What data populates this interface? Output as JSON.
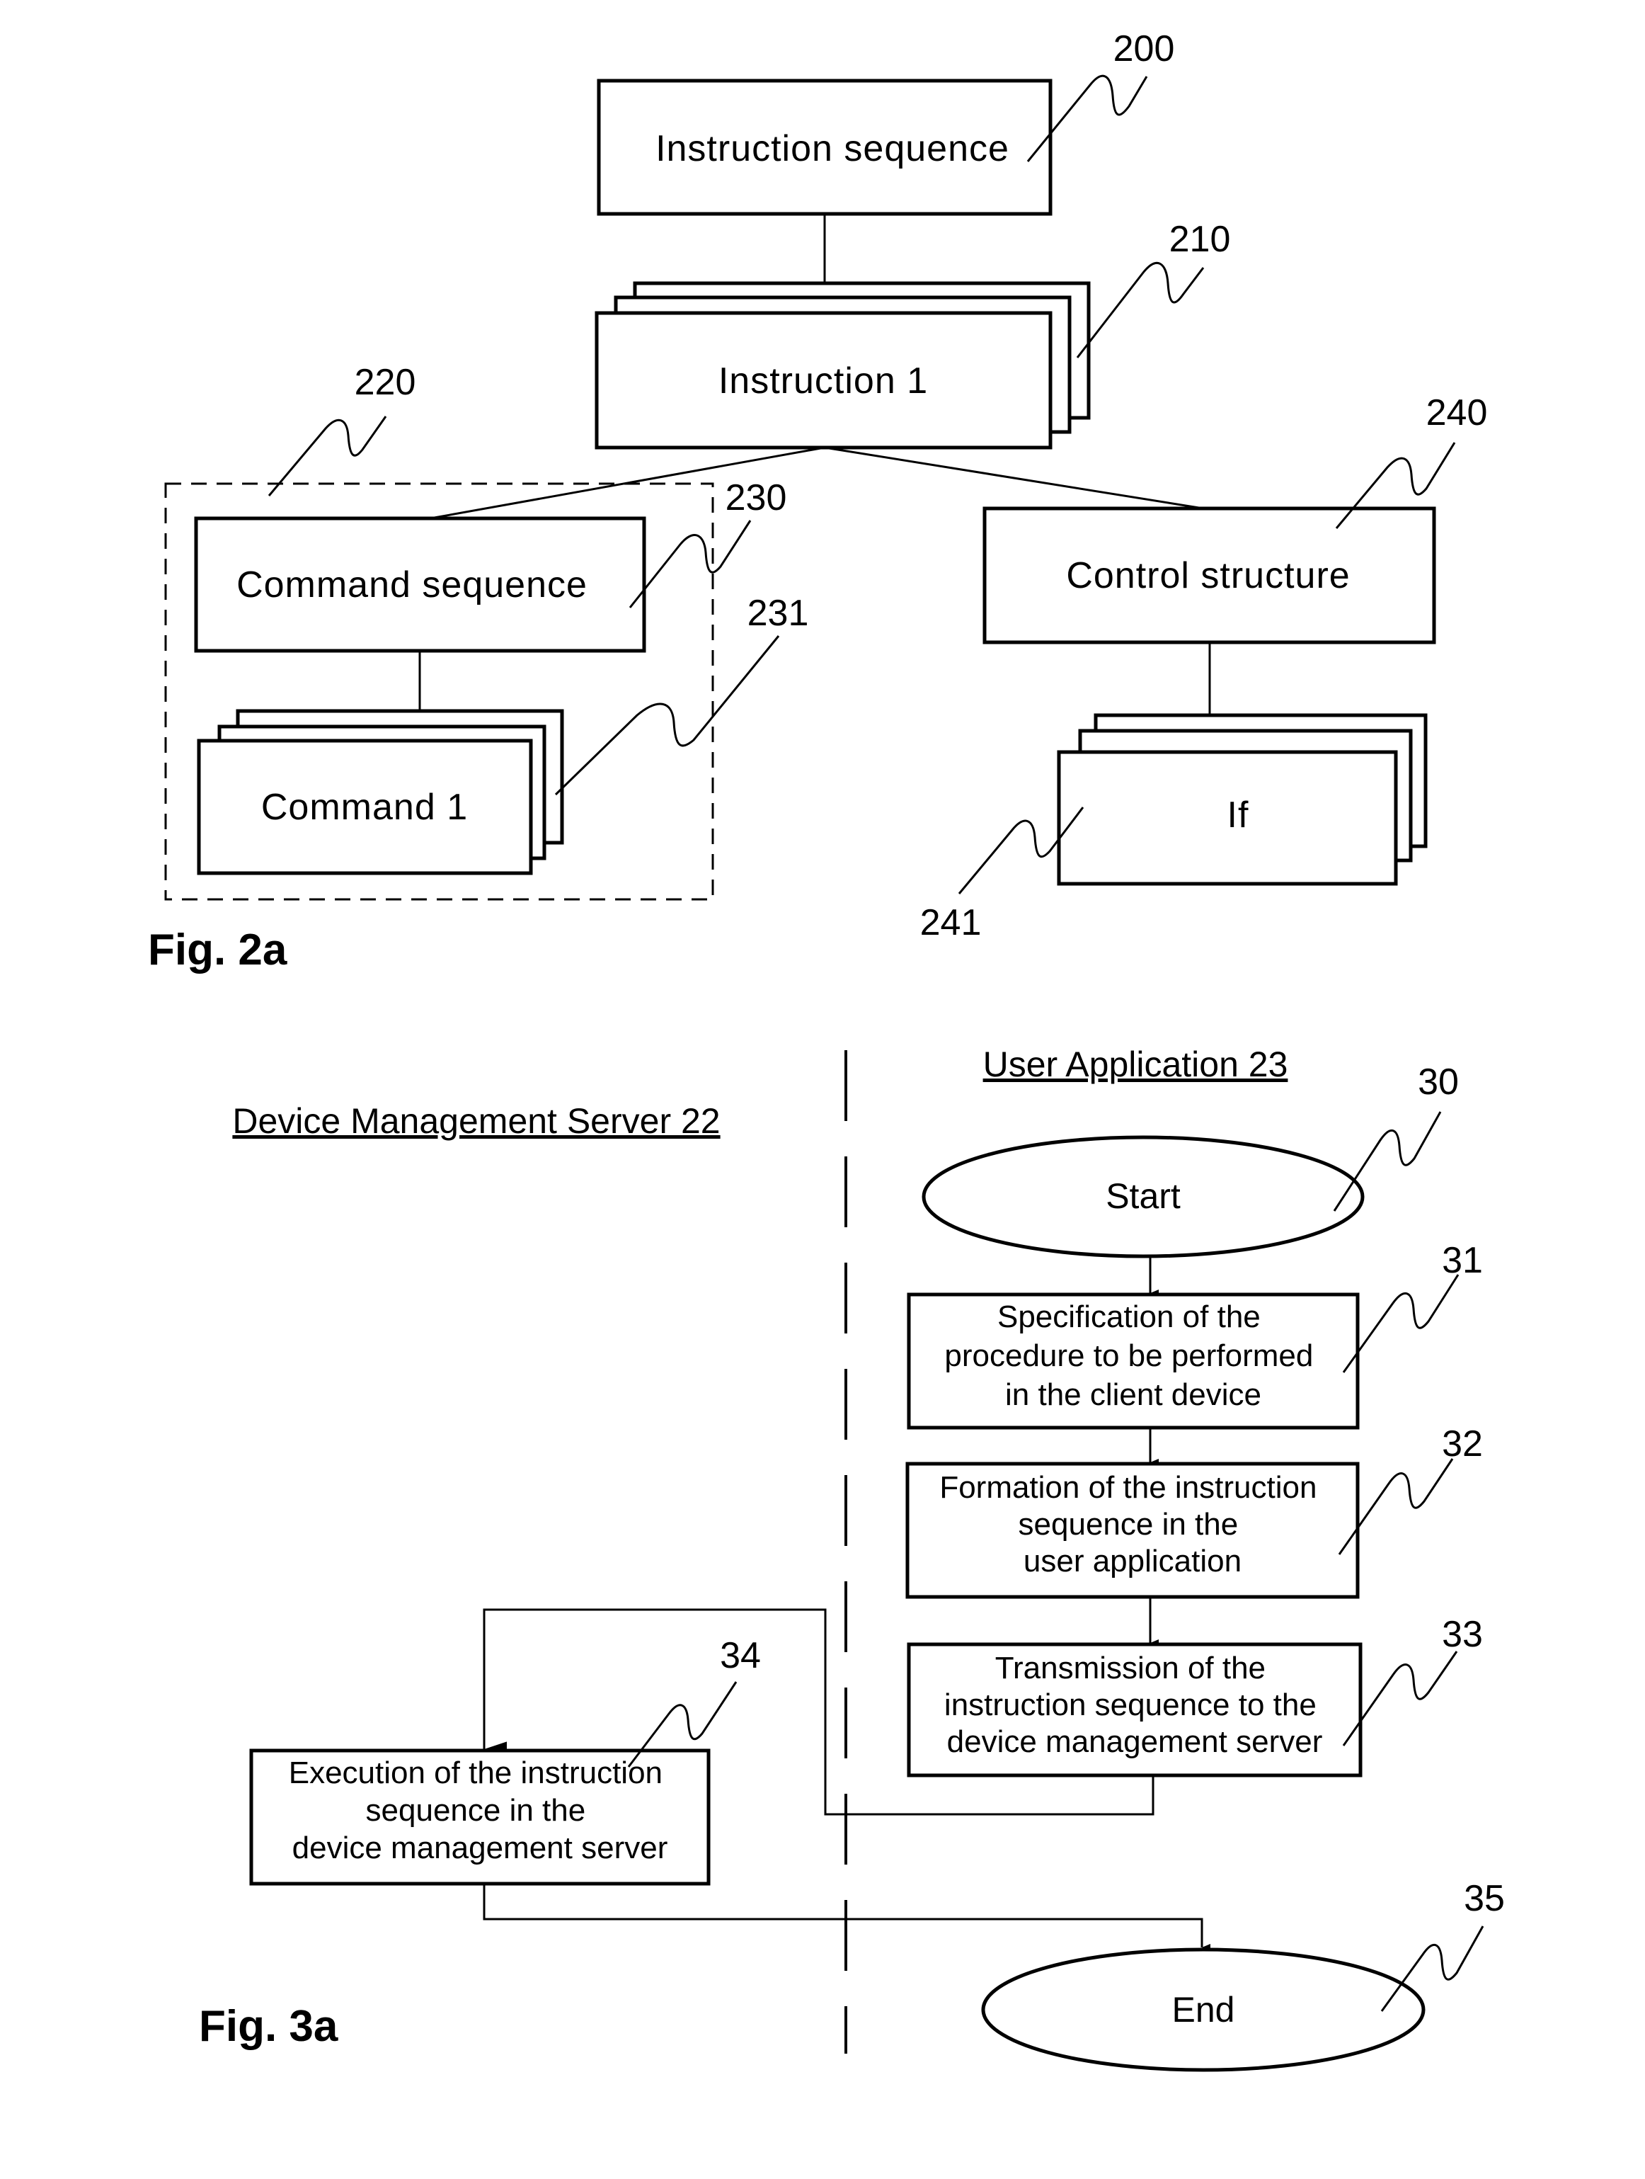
{
  "fig2a": {
    "caption": "Fig. 2a",
    "instruction_sequence": {
      "label": "Instruction sequence",
      "ref": "200"
    },
    "instruction": {
      "label": "Instruction 1",
      "ref": "210"
    },
    "command_group": {
      "ref": "220"
    },
    "command_sequence": {
      "label": "Command sequence",
      "ref": "230"
    },
    "command": {
      "label": "Command 1",
      "ref": "231"
    },
    "control_structure": {
      "label": "Control structure",
      "ref": "240"
    },
    "if_block": {
      "label": "If",
      "ref": "241"
    }
  },
  "fig3a": {
    "caption": "Fig. 3a",
    "lanes": {
      "left": "Device Management Server 22",
      "right": "User Application 23"
    },
    "start": {
      "label": "Start",
      "ref": "30"
    },
    "steps": [
      {
        "ref": "31",
        "lines": [
          "Specification of the",
          "procedure to be performed",
          "in the client device"
        ]
      },
      {
        "ref": "32",
        "lines": [
          "Formation of the instruction",
          "sequence in the",
          "user application"
        ]
      },
      {
        "ref": "33",
        "lines": [
          "Transmission of the",
          "instruction sequence to the",
          "device management server"
        ]
      },
      {
        "ref": "34",
        "lines": [
          "Execution of the instruction",
          "sequence in the",
          "device management server"
        ]
      }
    ],
    "end": {
      "label": "End",
      "ref": "35"
    }
  }
}
